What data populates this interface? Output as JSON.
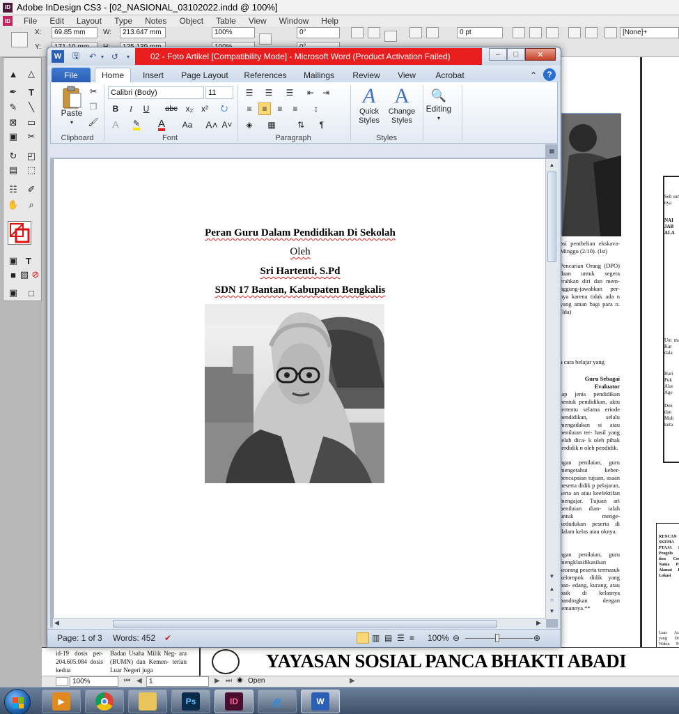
{
  "indesign": {
    "title": "Adobe InDesign CS3 - [02_NASIONAL_03102022.indd @ 100%]",
    "menu": [
      "File",
      "Edit",
      "Layout",
      "Type",
      "Notes",
      "Object",
      "Table",
      "View",
      "Window",
      "Help"
    ],
    "control": {
      "x_label": "X:",
      "x_value": "69.85 mm",
      "y_label": "Y:",
      "y_value": "171.10 mm",
      "w_label": "W:",
      "w_value": "213.647 mm",
      "h_label": "H:",
      "h_value": "125.139 mm",
      "scale_x": "100%",
      "scale_y": "100%",
      "angle": "0°",
      "shear": "0°",
      "stroke": "0 pt",
      "zoom_field": "100%",
      "style": "[None]+"
    },
    "newspaper": {
      "caption": "psi pembelian ekskava- Minggu (2/10). (Ist)",
      "dpo_text": "Pencarian Orang (DPO) daan untuk segera erahkan diri dan mem- nggung-jawabkan per- nya karena tidak ada n yang aman bagi para n. (Ida)",
      "text1": "a cara belajar yang",
      "heading": "Guru Sebagai Evaluator",
      "text2": "iap jenis pendidikan bentuk pendidikan, aktu tertentu selama eriode pendidikan, selalu mengadakan si atau penilaian ter- hasil yang telah dica- k oleh pihak terdidik n oleh pendidik.",
      "text3": "ngan penilaian, guru mengetahui keber- pencapaian tujuan, asaan peserta didik p pelajaran, serta an atau keefektifan mengajar. Tujuan ari penilaian dian- ialah untuk menge- kedudukan peserta di dalam kelas atau oknya.",
      "text4": "ngan penilaian, guru mengklasifikasikan seorang peserta termasuk kelompok didik yang pan- edang, kurang, atau baik di kelasnya bandingkan dengan temannya.**",
      "col_left": "id-19 dosis per- 204.605.084 dosis kedua",
      "col_mid": "Badan Usaha Milik Neg- ara (BUMN) dan Kemen- terian Luar Negeri juga",
      "banner": "YAYASAN SOSIAL PANCA BHAKTI ABADI",
      "side_a": "Seh sun nya",
      "side_b": "NAI JAB ALA",
      "side_c": "Unt ma Kar dala",
      "side_d": "Hari Puk Alar Age",
      "side_e": "Den dan Moh kuta",
      "side_f": "RENCAN SKEMA PTAJA S Pengelo tion Coo Nama Pe Alamat P Lokasi",
      "side_g": "Luas Ara yang Dis Waktu Pe Terkait d kepada masukar kami me lambatn"
    },
    "status": {
      "zoom": "100%",
      "page": "1",
      "state": "Open"
    }
  },
  "word": {
    "title": "02 - Foto Artikel [Compatibility Mode] - Microsoft Word (Product Activation Failed)",
    "tabs": [
      "File",
      "Home",
      "Insert",
      "Page Layout",
      "References",
      "Mailings",
      "Review",
      "View",
      "Acrobat"
    ],
    "ribbon": {
      "paste": "Paste",
      "clipboard": "Clipboard",
      "font_name": "Calibri (Body)",
      "font_size": "11",
      "font": "Font",
      "paragraph": "Paragraph",
      "quick_styles": "Quick Styles",
      "change_styles": "Change Styles",
      "styles": "Styles",
      "editing": "Editing"
    },
    "doc": {
      "title": "Peran Guru Dalam Pendidikan Di Sekolah",
      "by": "Oleh",
      "author": "Sri Hartenti, S.Pd",
      "school": "SDN 17 Bantan, Kabupaten Bengkalis"
    },
    "status": {
      "page": "Page: 1 of 3",
      "words": "Words: 452",
      "zoom": "100%"
    }
  },
  "taskbar": {
    "apps": [
      "Windows Media Player",
      "Google Chrome",
      "Windows Explorer",
      "Adobe Photoshop",
      "Adobe InDesign",
      "Internet Explorer",
      "Microsoft Word"
    ]
  }
}
